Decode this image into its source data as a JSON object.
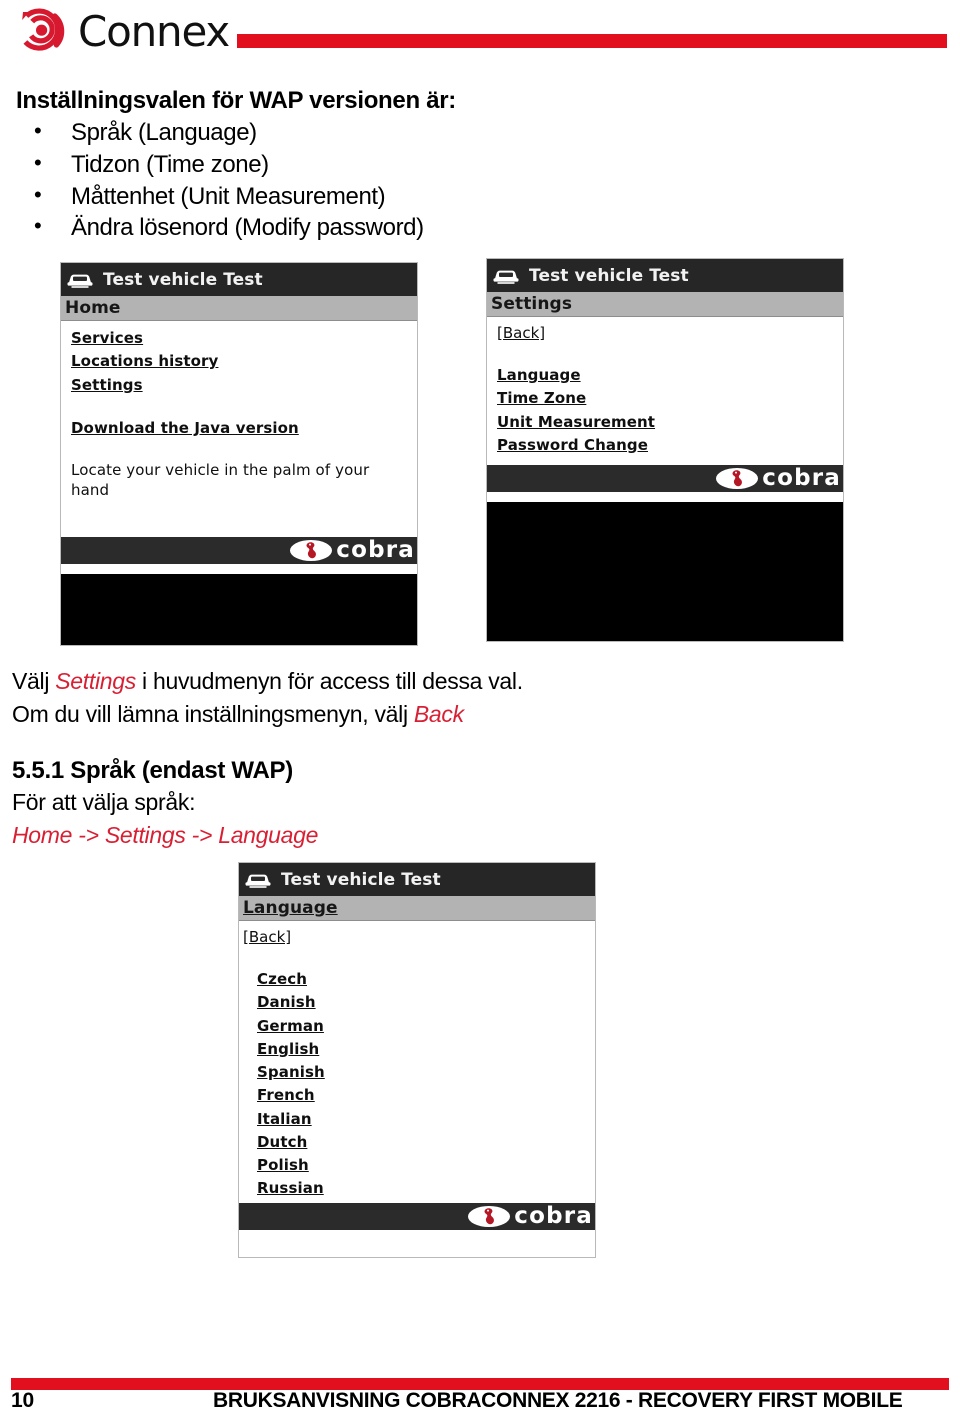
{
  "header": {
    "brand_name": "Connex",
    "logo_icon": "connex-spiral-icon",
    "accent_color": "#e2101e"
  },
  "content": {
    "lead_title": "Inställningsvalen för WAP versionen är:",
    "bullets": [
      "Språk (Language)",
      "Tidzon (Time zone)",
      "Måttenhet (Unit Measurement)",
      "Ändra lösenord (Modify password)"
    ]
  },
  "screenshots": {
    "home": {
      "title": "Test vehicle Test",
      "subtitle": "Home",
      "menu_items": [
        "Services",
        "Locations history",
        "Settings"
      ],
      "download_link": "Download the Java version",
      "tagline": "Locate your vehicle in the palm of your hand",
      "brand": "cobra"
    },
    "settings": {
      "title": "Test vehicle Test",
      "subtitle": "Settings",
      "back_label": "[Back]",
      "menu_items": [
        "Language",
        "Time Zone",
        "Unit Measurement",
        "Password Change"
      ],
      "brand": "cobra"
    },
    "language": {
      "title": "Test vehicle Test",
      "subtitle": "Language",
      "back_label": "[Back]",
      "menu_items": [
        "Czech",
        "Danish",
        "German",
        "English",
        "Spanish",
        "French",
        "Italian",
        "Dutch",
        "Polish",
        "Russian"
      ],
      "brand": "cobra"
    }
  },
  "paragraphs": {
    "p1_before": "Välj ",
    "p1_accent": "Settings",
    "p1_after": " i huvudmenyn för access till dessa val.",
    "p2_before": "Om du vill lämna inställningsmenyn, välj ",
    "p2_accent": "Back",
    "section_heading": "5.5.1 Språk (endast WAP)",
    "section_intro": "För att välja språk:",
    "section_path": "Home -> Settings -> Language"
  },
  "footer": {
    "page_number": "10",
    "title": "BRUKSANVISNING COBRACONNEX 2216 - RECOVERY FIRST MOBILE",
    "accent_color": "#e2101e"
  }
}
